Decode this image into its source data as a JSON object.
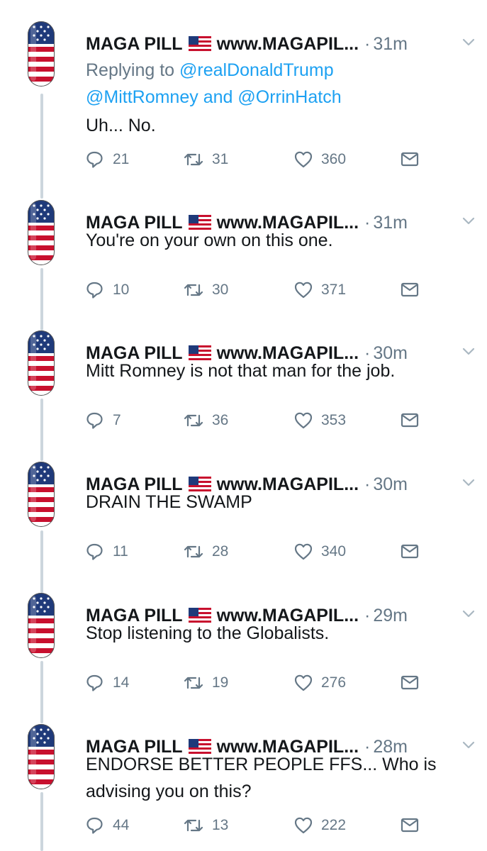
{
  "tweets": [
    {
      "name": "MAGA PILL",
      "handle": "www.MAGAPIL...",
      "time": "31m",
      "reply_prefix": "Replying to",
      "reply_to_1": "@realDonaldTrump",
      "reply_to_2": "@MittRomney",
      "reply_and": "and",
      "reply_to_3": "@OrrinHatch",
      "text": "Uh... No.",
      "replies": "21",
      "retweets": "31",
      "likes": "360"
    },
    {
      "name": "MAGA PILL",
      "handle": "www.MAGAPIL...",
      "time": "31m",
      "text": "You're on your own on this one.",
      "replies": "10",
      "retweets": "30",
      "likes": "371"
    },
    {
      "name": "MAGA PILL",
      "handle": "www.MAGAPIL...",
      "time": "30m",
      "text": "Mitt Romney is not that man for the job.",
      "replies": "7",
      "retweets": "36",
      "likes": "353"
    },
    {
      "name": "MAGA PILL",
      "handle": "www.MAGAPIL...",
      "time": "30m",
      "text": "DRAIN THE SWAMP",
      "replies": "11",
      "retweets": "28",
      "likes": "340"
    },
    {
      "name": "MAGA PILL",
      "handle": "www.MAGAPIL...",
      "time": "29m",
      "text": "Stop listening to the Globalists.",
      "replies": "14",
      "retweets": "19",
      "likes": "276"
    },
    {
      "name": "MAGA PILL",
      "handle": "www.MAGAPIL...",
      "time": "28m",
      "text_line1": "ENDORSE BETTER PEOPLE FFS... Who is",
      "text_line2": "advising you on this?",
      "replies": "44",
      "retweets": "13",
      "likes": "222"
    }
  ],
  "colors": {
    "text": "#14171a",
    "muted": "#657786",
    "link": "#1da1f2",
    "thread": "#ccd6dd"
  },
  "icons": [
    "pill-flag-avatar-icon",
    "us-flag-icon",
    "chevron-down-icon",
    "reply-icon",
    "retweet-icon",
    "like-icon",
    "dm-icon"
  ]
}
